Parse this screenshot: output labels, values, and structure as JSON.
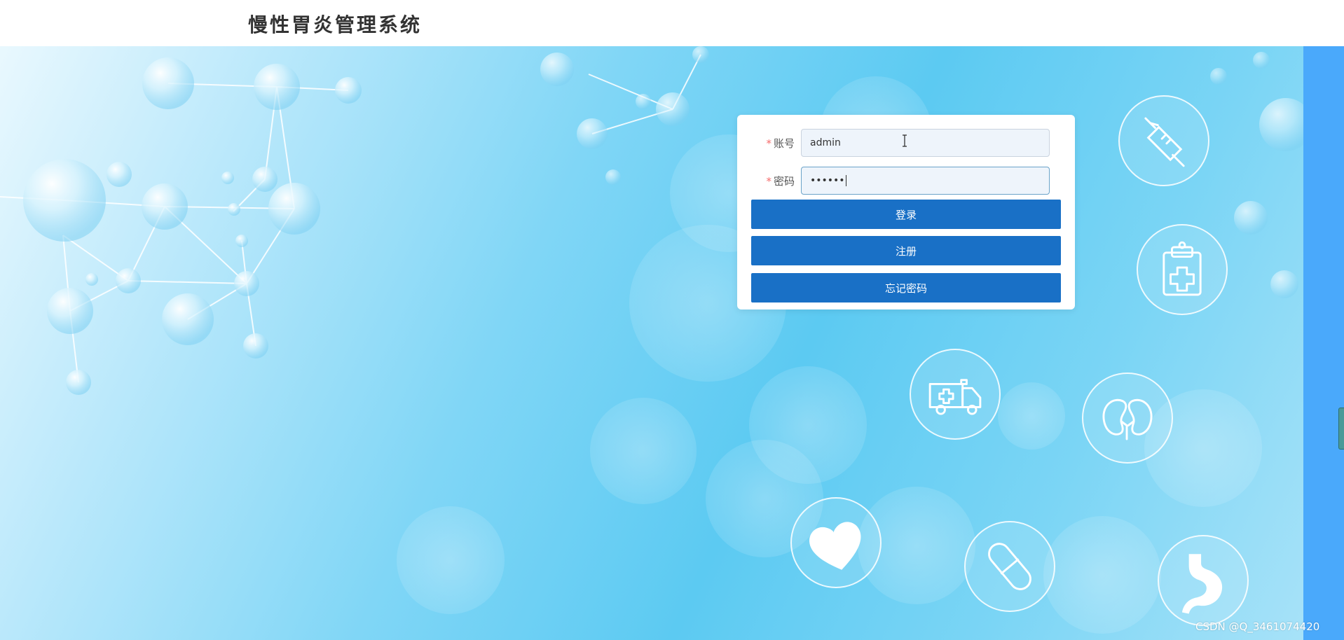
{
  "header": {
    "title": "慢性胃炎管理系统"
  },
  "login_form": {
    "account_label": "账号",
    "account_value": "admin",
    "password_label": "密码",
    "password_value": "••••••",
    "required_mark": "*",
    "login_button": "登录",
    "register_button": "注册",
    "forgot_button": "忘记密码"
  },
  "icons": [
    "syringe-icon",
    "clipboard-medical-icon",
    "ambulance-icon",
    "kidneys-icon",
    "heart-icon",
    "pill-icon",
    "stomach-icon",
    "text-cursor-icon"
  ],
  "watermark": "CSDN @Q_3461074420",
  "colors": {
    "button": "#1970c6",
    "header_text": "#333333",
    "right_strip": "#4aa9fb",
    "required": "#f56c6c"
  }
}
